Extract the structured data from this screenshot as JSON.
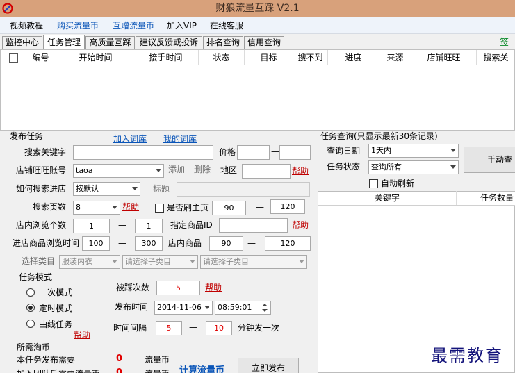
{
  "window": {
    "title": "财狼流量互踩  V2.1"
  },
  "menu": [
    "视频教程",
    "购买流量币",
    "互赠流量币",
    "加入VIP",
    "在线客服"
  ],
  "tabs": [
    "监控中心",
    "任务管理",
    "高质量互踩",
    "建议反馈或投诉",
    "排名查询",
    "信用查询"
  ],
  "tab_sign": "签至",
  "grid": {
    "columns": [
      "编号",
      "开始时间",
      "接手时间",
      "状态",
      "目标",
      "搜不到",
      "进度",
      "来源",
      "店铺旺旺",
      "搜索关"
    ]
  },
  "publish": {
    "section_title": "发布任务",
    "add_lexicon": "加入词库",
    "my_lexicon": "我的词库",
    "keyword_label": "搜索关键字",
    "price_label": "价格",
    "dash": "—",
    "shop_label": "店铺旺旺账号",
    "shop_value": "taoa",
    "add_btn": "添加",
    "delete_btn": "删除",
    "region_label": "地区",
    "help": "帮助",
    "how_label": "如何搜索进店",
    "how_value": "按默认",
    "title_label": "标题",
    "pages_label": "搜索页数",
    "pages_value": "8",
    "mainpage_label": "是否刷主页",
    "mainpage_min": "90",
    "mainpage_max": "120",
    "browse_label": "店内浏览个数",
    "browse_min": "1",
    "browse_max": "1",
    "product_id_label": "指定商品ID",
    "time_label": "进店商品浏览时间",
    "time_min": "100",
    "time_max": "300",
    "inshop_label": "店内商品",
    "inshop_min": "90",
    "inshop_max": "120",
    "category_label": "选择类目",
    "category_value": "服装内衣",
    "subcategory1": "请选择子类目",
    "subcategory2": "请选择子类目"
  },
  "mode": {
    "title": "任务模式",
    "once": "一次模式",
    "timed": "定时模式",
    "curve": "曲线任务",
    "help": "帮助",
    "clicks_label": "被踩次数",
    "clicks_value": "5",
    "publish_time_label": "发布时间",
    "publish_date": "2014-11-06",
    "publish_clock": "08:59:01",
    "interval_label": "时间间隔",
    "interval_min": "5",
    "interval_max": "10",
    "interval_unit": "分钟发一次"
  },
  "cost": {
    "title": "所需淘币",
    "row1_label": "本任务发布需要",
    "row1_value": "0",
    "unit": "流量币",
    "row2_label": "加入团队后需要流量币",
    "row2_value": "0",
    "calc_link": "计算流量币",
    "publish_btn": "立即发布"
  },
  "query": {
    "title": "任务查询(只显示最新30条记录)",
    "date_label": "查询日期",
    "date_value": "1天内",
    "status_label": "任务状态",
    "status_value": "查询所有",
    "manual_btn": "手动查",
    "auto_refresh": "自动刷新",
    "columns": [
      "关键字",
      "任务数量"
    ]
  },
  "watermark": "最需教育",
  "colors": {
    "titlebar": "#d8a17b",
    "accent_blue": "#0a55b8",
    "help_red": "#c00000",
    "value_red": "#e00000"
  }
}
